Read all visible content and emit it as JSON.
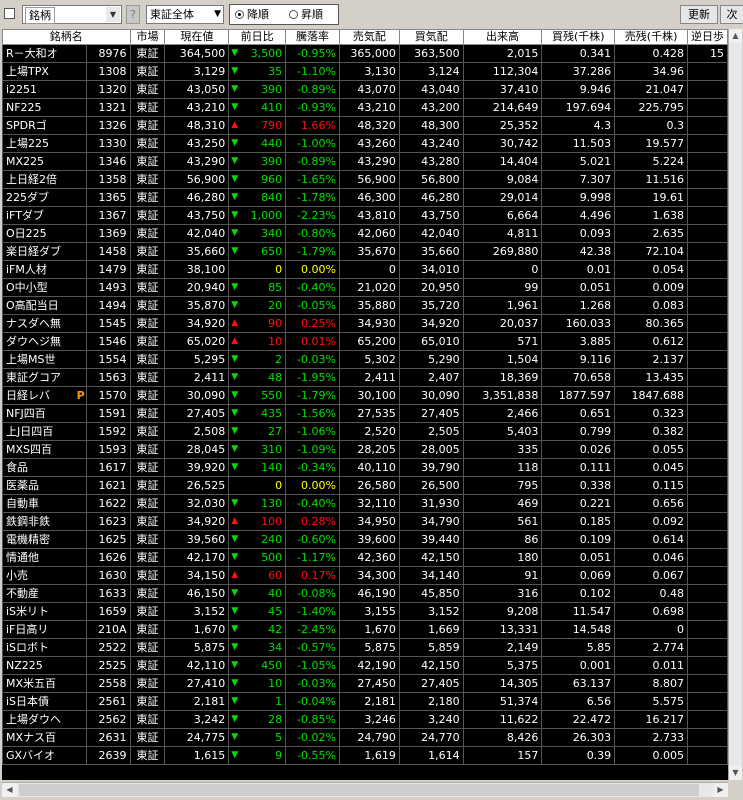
{
  "toolbar": {
    "symbol_label": "銘柄",
    "help": "?",
    "market": "東証全体",
    "sort_desc": "降順",
    "sort_asc": "昇順",
    "refresh": "更新",
    "next": "次"
  },
  "columns": [
    "銘柄名",
    "市場",
    "現在値",
    "前日比",
    "騰落率",
    "売気配",
    "買気配",
    "出来高",
    "買残(千株)",
    "売残(千株)",
    "逆日歩"
  ],
  "rows": [
    {
      "name": "R－大和オ",
      "code": "8976",
      "market": "東証",
      "price": "364,500",
      "dir": "down",
      "change": "3,500",
      "rate": "-0.95%",
      "ask": "365,000",
      "bid": "363,500",
      "volume": "2,015",
      "buy_rem": "0.341",
      "sell_rem": "0.428",
      "gyaku": "15"
    },
    {
      "name": "上場TPX",
      "code": "1308",
      "market": "東証",
      "price": "3,129",
      "dir": "down",
      "change": "35",
      "rate": "-1.10%",
      "ask": "3,130",
      "bid": "3,124",
      "volume": "112,304",
      "buy_rem": "37.286",
      "sell_rem": "34.96",
      "gyaku": ""
    },
    {
      "name": "i2251",
      "code": "1320",
      "market": "東証",
      "price": "43,050",
      "dir": "down",
      "change": "390",
      "rate": "-0.89%",
      "ask": "43,070",
      "bid": "43,040",
      "volume": "37,410",
      "buy_rem": "9.946",
      "sell_rem": "21.047",
      "gyaku": ""
    },
    {
      "name": "NF225",
      "code": "1321",
      "market": "東証",
      "price": "43,210",
      "dir": "down",
      "change": "410",
      "rate": "-0.93%",
      "ask": "43,210",
      "bid": "43,200",
      "volume": "214,649",
      "buy_rem": "197.694",
      "sell_rem": "225.795",
      "gyaku": ""
    },
    {
      "name": "SPDRゴ",
      "code": "1326",
      "market": "東証",
      "price": "48,310",
      "dir": "up",
      "change": "790",
      "rate": "1.66%",
      "ask": "48,320",
      "bid": "48,300",
      "volume": "25,352",
      "buy_rem": "4.3",
      "sell_rem": "0.3",
      "gyaku": ""
    },
    {
      "name": "上場225",
      "code": "1330",
      "market": "東証",
      "price": "43,250",
      "dir": "down",
      "change": "440",
      "rate": "-1.00%",
      "ask": "43,260",
      "bid": "43,240",
      "volume": "30,742",
      "buy_rem": "11.503",
      "sell_rem": "19.577",
      "gyaku": ""
    },
    {
      "name": "MX225",
      "code": "1346",
      "market": "東証",
      "price": "43,290",
      "dir": "down",
      "change": "390",
      "rate": "-0.89%",
      "ask": "43,290",
      "bid": "43,280",
      "volume": "14,404",
      "buy_rem": "5.021",
      "sell_rem": "5.224",
      "gyaku": ""
    },
    {
      "name": "上日経2倍",
      "code": "1358",
      "market": "東証",
      "price": "56,900",
      "dir": "down",
      "change": "960",
      "rate": "-1.65%",
      "ask": "56,900",
      "bid": "56,800",
      "volume": "9,084",
      "buy_rem": "7.307",
      "sell_rem": "11.516",
      "gyaku": ""
    },
    {
      "name": "225ダブ",
      "code": "1365",
      "market": "東証",
      "price": "46,280",
      "dir": "down",
      "change": "840",
      "rate": "-1.78%",
      "ask": "46,300",
      "bid": "46,280",
      "volume": "29,014",
      "buy_rem": "9.998",
      "sell_rem": "19.61",
      "gyaku": ""
    },
    {
      "name": "iFTダブ",
      "code": "1367",
      "market": "東証",
      "price": "43,750",
      "dir": "down",
      "change": "1,000",
      "rate": "-2.23%",
      "ask": "43,810",
      "bid": "43,750",
      "volume": "6,664",
      "buy_rem": "4.496",
      "sell_rem": "1.638",
      "gyaku": ""
    },
    {
      "name": "O日225",
      "code": "1369",
      "market": "東証",
      "price": "42,040",
      "dir": "down",
      "change": "340",
      "rate": "-0.80%",
      "ask": "42,060",
      "bid": "42,040",
      "volume": "4,811",
      "buy_rem": "0.093",
      "sell_rem": "2.635",
      "gyaku": ""
    },
    {
      "name": "楽日経ダブ",
      "code": "1458",
      "market": "東証",
      "price": "35,660",
      "dir": "down",
      "change": "650",
      "rate": "-1.79%",
      "ask": "35,670",
      "bid": "35,660",
      "volume": "269,880",
      "buy_rem": "42.38",
      "sell_rem": "72.104",
      "gyaku": ""
    },
    {
      "name": "iFM人材",
      "code": "1479",
      "market": "東証",
      "price": "38,100",
      "dir": "zero",
      "change": "0",
      "rate": "0.00%",
      "ask": "0",
      "bid": "34,010",
      "volume": "0",
      "buy_rem": "0.01",
      "sell_rem": "0.054",
      "gyaku": ""
    },
    {
      "name": "O中小型",
      "code": "1493",
      "market": "東証",
      "price": "20,940",
      "dir": "down",
      "change": "85",
      "rate": "-0.40%",
      "ask": "21,020",
      "bid": "20,950",
      "volume": "99",
      "buy_rem": "0.051",
      "sell_rem": "0.009",
      "gyaku": ""
    },
    {
      "name": "O高配当日",
      "code": "1494",
      "market": "東証",
      "price": "35,870",
      "dir": "down",
      "change": "20",
      "rate": "-0.05%",
      "ask": "35,880",
      "bid": "35,720",
      "volume": "1,961",
      "buy_rem": "1.268",
      "sell_rem": "0.083",
      "gyaku": ""
    },
    {
      "name": "ナスダへ無",
      "code": "1545",
      "market": "東証",
      "price": "34,920",
      "dir": "up",
      "change": "90",
      "rate": "0.25%",
      "ask": "34,930",
      "bid": "34,920",
      "volume": "20,037",
      "buy_rem": "160.033",
      "sell_rem": "80.365",
      "gyaku": ""
    },
    {
      "name": "ダウヘジ無",
      "code": "1546",
      "market": "東証",
      "price": "65,020",
      "dir": "up",
      "change": "10",
      "rate": "0.01%",
      "ask": "65,200",
      "bid": "65,010",
      "volume": "571",
      "buy_rem": "3.885",
      "sell_rem": "0.612",
      "gyaku": ""
    },
    {
      "name": "上場MS世",
      "code": "1554",
      "market": "東証",
      "price": "5,295",
      "dir": "down",
      "change": "2",
      "rate": "-0.03%",
      "ask": "5,302",
      "bid": "5,290",
      "volume": "1,504",
      "buy_rem": "9.116",
      "sell_rem": "2.137",
      "gyaku": ""
    },
    {
      "name": "東証グコア",
      "code": "1563",
      "market": "東証",
      "price": "2,411",
      "dir": "down",
      "change": "48",
      "rate": "-1.95%",
      "ask": "2,411",
      "bid": "2,407",
      "volume": "18,369",
      "buy_rem": "70.658",
      "sell_rem": "13.435",
      "gyaku": ""
    },
    {
      "name": "日経レバ",
      "code": "1570",
      "market": "東証",
      "price": "30,090",
      "dir": "down",
      "change": "550",
      "rate": "-1.79%",
      "ask": "30,100",
      "bid": "30,090",
      "volume": "3,351,838",
      "buy_rem": "1877.597",
      "sell_rem": "1847.688",
      "gyaku": "",
      "badge": "P"
    },
    {
      "name": "NFJ四百",
      "code": "1591",
      "market": "東証",
      "price": "27,405",
      "dir": "down",
      "change": "435",
      "rate": "-1.56%",
      "ask": "27,535",
      "bid": "27,405",
      "volume": "2,466",
      "buy_rem": "0.651",
      "sell_rem": "0.323",
      "gyaku": ""
    },
    {
      "name": "上J日四百",
      "code": "1592",
      "market": "東証",
      "price": "2,508",
      "dir": "down",
      "change": "27",
      "rate": "-1.06%",
      "ask": "2,520",
      "bid": "2,505",
      "volume": "5,403",
      "buy_rem": "0.799",
      "sell_rem": "0.382",
      "gyaku": ""
    },
    {
      "name": "MXS四百",
      "code": "1593",
      "market": "東証",
      "price": "28,045",
      "dir": "down",
      "change": "310",
      "rate": "-1.09%",
      "ask": "28,205",
      "bid": "28,005",
      "volume": "335",
      "buy_rem": "0.026",
      "sell_rem": "0.055",
      "gyaku": ""
    },
    {
      "name": "食品",
      "code": "1617",
      "market": "東証",
      "price": "39,920",
      "dir": "down",
      "change": "140",
      "rate": "-0.34%",
      "ask": "40,110",
      "bid": "39,790",
      "volume": "118",
      "buy_rem": "0.111",
      "sell_rem": "0.045",
      "gyaku": ""
    },
    {
      "name": "医薬品",
      "code": "1621",
      "market": "東証",
      "price": "26,525",
      "dir": "zero",
      "change": "0",
      "rate": "0.00%",
      "ask": "26,580",
      "bid": "26,500",
      "volume": "795",
      "buy_rem": "0.338",
      "sell_rem": "0.115",
      "gyaku": ""
    },
    {
      "name": "自動車",
      "code": "1622",
      "market": "東証",
      "price": "32,030",
      "dir": "down",
      "change": "130",
      "rate": "-0.40%",
      "ask": "32,110",
      "bid": "31,930",
      "volume": "469",
      "buy_rem": "0.221",
      "sell_rem": "0.656",
      "gyaku": ""
    },
    {
      "name": "鉄鋼非鉄",
      "code": "1623",
      "market": "東証",
      "price": "34,920",
      "dir": "up",
      "change": "100",
      "rate": "0.28%",
      "ask": "34,950",
      "bid": "34,790",
      "volume": "561",
      "buy_rem": "0.185",
      "sell_rem": "0.092",
      "gyaku": ""
    },
    {
      "name": "電機精密",
      "code": "1625",
      "market": "東証",
      "price": "39,560",
      "dir": "down",
      "change": "240",
      "rate": "-0.60%",
      "ask": "39,600",
      "bid": "39,440",
      "volume": "86",
      "buy_rem": "0.109",
      "sell_rem": "0.614",
      "gyaku": ""
    },
    {
      "name": "情通他",
      "code": "1626",
      "market": "東証",
      "price": "42,170",
      "dir": "down",
      "change": "500",
      "rate": "-1.17%",
      "ask": "42,360",
      "bid": "42,150",
      "volume": "180",
      "buy_rem": "0.051",
      "sell_rem": "0.046",
      "gyaku": ""
    },
    {
      "name": "小売",
      "code": "1630",
      "market": "東証",
      "price": "34,150",
      "dir": "up",
      "change": "60",
      "rate": "0.17%",
      "ask": "34,300",
      "bid": "34,140",
      "volume": "91",
      "buy_rem": "0.069",
      "sell_rem": "0.067",
      "gyaku": ""
    },
    {
      "name": "不動産",
      "code": "1633",
      "market": "東証",
      "price": "46,150",
      "dir": "down",
      "change": "40",
      "rate": "-0.08%",
      "ask": "46,190",
      "bid": "45,850",
      "volume": "316",
      "buy_rem": "0.102",
      "sell_rem": "0.48",
      "gyaku": ""
    },
    {
      "name": "iS米リト",
      "code": "1659",
      "market": "東証",
      "price": "3,152",
      "dir": "down",
      "change": "45",
      "rate": "-1.40%",
      "ask": "3,155",
      "bid": "3,152",
      "volume": "9,208",
      "buy_rem": "11.547",
      "sell_rem": "0.698",
      "gyaku": ""
    },
    {
      "name": "iF日高リ",
      "code": "210A",
      "market": "東証",
      "price": "1,670",
      "dir": "down",
      "change": "42",
      "rate": "-2.45%",
      "ask": "1,670",
      "bid": "1,669",
      "volume": "13,331",
      "buy_rem": "14.548",
      "sell_rem": "0",
      "gyaku": ""
    },
    {
      "name": "iSロボト",
      "code": "2522",
      "market": "東証",
      "price": "5,875",
      "dir": "down",
      "change": "34",
      "rate": "-0.57%",
      "ask": "5,875",
      "bid": "5,859",
      "volume": "2,149",
      "buy_rem": "5.85",
      "sell_rem": "2.774",
      "gyaku": ""
    },
    {
      "name": "NZ225",
      "code": "2525",
      "market": "東証",
      "price": "42,110",
      "dir": "down",
      "change": "450",
      "rate": "-1.05%",
      "ask": "42,190",
      "bid": "42,150",
      "volume": "5,375",
      "buy_rem": "0.001",
      "sell_rem": "0.011",
      "gyaku": ""
    },
    {
      "name": "MX米五百",
      "code": "2558",
      "market": "東証",
      "price": "27,410",
      "dir": "down",
      "change": "10",
      "rate": "-0.03%",
      "ask": "27,450",
      "bid": "27,405",
      "volume": "14,305",
      "buy_rem": "63.137",
      "sell_rem": "8.807",
      "gyaku": ""
    },
    {
      "name": "iS日本債",
      "code": "2561",
      "market": "東証",
      "price": "2,181",
      "dir": "down",
      "change": "1",
      "rate": "-0.04%",
      "ask": "2,181",
      "bid": "2,180",
      "volume": "51,374",
      "buy_rem": "6.56",
      "sell_rem": "5.575",
      "gyaku": ""
    },
    {
      "name": "上場ダウヘ",
      "code": "2562",
      "market": "東証",
      "price": "3,242",
      "dir": "down",
      "change": "28",
      "rate": "-0.85%",
      "ask": "3,246",
      "bid": "3,240",
      "volume": "11,622",
      "buy_rem": "22.472",
      "sell_rem": "16.217",
      "gyaku": ""
    },
    {
      "name": "MXナス百",
      "code": "2631",
      "market": "東証",
      "price": "24,775",
      "dir": "down",
      "change": "5",
      "rate": "-0.02%",
      "ask": "24,790",
      "bid": "24,770",
      "volume": "8,426",
      "buy_rem": "26.303",
      "sell_rem": "2.733",
      "gyaku": ""
    },
    {
      "name": "GXバイオ",
      "code": "2639",
      "market": "東証",
      "price": "1,615",
      "dir": "down",
      "change": "9",
      "rate": "-0.55%",
      "ask": "1,619",
      "bid": "1,614",
      "volume": "157",
      "buy_rem": "0.39",
      "sell_rem": "0.005",
      "gyaku": ""
    }
  ],
  "colors": {
    "down": "#00e000",
    "up": "#ff1010",
    "zero": "#ffff00",
    "badge": "#ff9900",
    "grid_bg": "#000000"
  },
  "icons": {
    "down": "triangle-down-icon",
    "up": "triangle-up-icon"
  }
}
